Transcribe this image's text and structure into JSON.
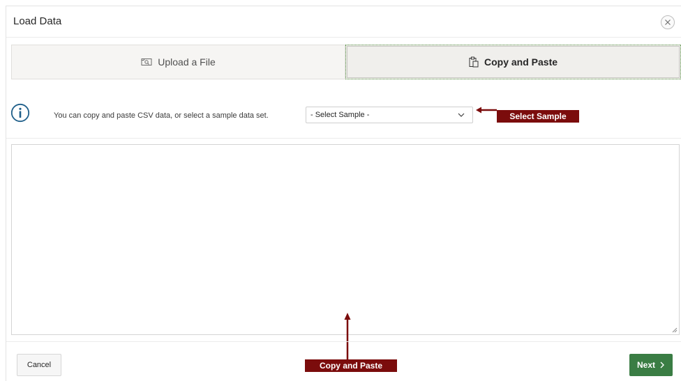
{
  "dialog": {
    "title": "Load Data"
  },
  "tabs": [
    {
      "label": "Upload a File",
      "icon": "upload-file-icon",
      "selected": false
    },
    {
      "label": "Copy and Paste",
      "icon": "clipboard-icon",
      "selected": true
    }
  ],
  "info": {
    "icon": "info-icon",
    "text": "You can copy and paste CSV data, or select a sample data set."
  },
  "sample_select": {
    "value": "- Select Sample -"
  },
  "paste_area": {
    "value": ""
  },
  "callouts": {
    "select_sample": "Select Sample",
    "copy_and_paste": "Copy and Paste",
    "color": "#7b0c0c"
  },
  "footer": {
    "cancel_label": "Cancel",
    "next_label": "Next",
    "next_icon": "chevron-right-icon",
    "next_color": "#3a7d44"
  }
}
